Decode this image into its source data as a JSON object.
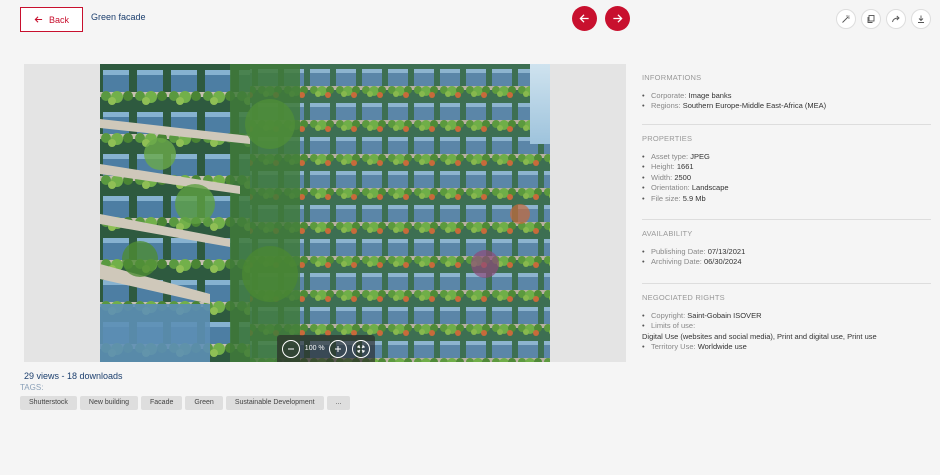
{
  "header": {
    "back_label": "Back",
    "asset_title": "Green facade"
  },
  "viewer": {
    "zoom_level": "100 %"
  },
  "stats": "29 views - 18 downloads",
  "tags_label": "TAGS:",
  "tags": [
    "Shutterstock",
    "New building",
    "Facade",
    "Green",
    "Sustainable Development",
    "..."
  ],
  "sidebar": {
    "informations": {
      "title": "INFORMATIONS",
      "corporate_label": "Corporate: ",
      "corporate_value": "Image banks",
      "regions_label": "Regions: ",
      "regions_value": "Southern Europe-Middle East-Africa (MEA)"
    },
    "properties": {
      "title": "PROPERTIES",
      "asset_type_label": "Asset type: ",
      "asset_type_value": "JPEG",
      "height_label": "Height: ",
      "height_value": "1661",
      "width_label": "Width: ",
      "width_value": "2500",
      "orientation_label": "Orientation: ",
      "orientation_value": "Landscape",
      "file_size_label": "File size: ",
      "file_size_value": "5.9 Mb"
    },
    "availability": {
      "title": "AVAILABILITY",
      "publishing_label": "Publishing Date: ",
      "publishing_value": "07/13/2021",
      "archiving_label": "Archiving Date: ",
      "archiving_value": "06/30/2024"
    },
    "rights": {
      "title": "NEGOCIATED RIGHTS",
      "copyright_label": "Copyright: ",
      "copyright_value": "Saint-Gobain ISOVER",
      "limits_label": "Limits of use:",
      "limits_value": "Digital Use (websites and social media), Print and digital use, Print use",
      "territory_label": "Territory Use: ",
      "territory_value": "Worldwide use"
    }
  },
  "colors": {
    "accent": "#c8102e",
    "link": "#1c3f6e"
  }
}
